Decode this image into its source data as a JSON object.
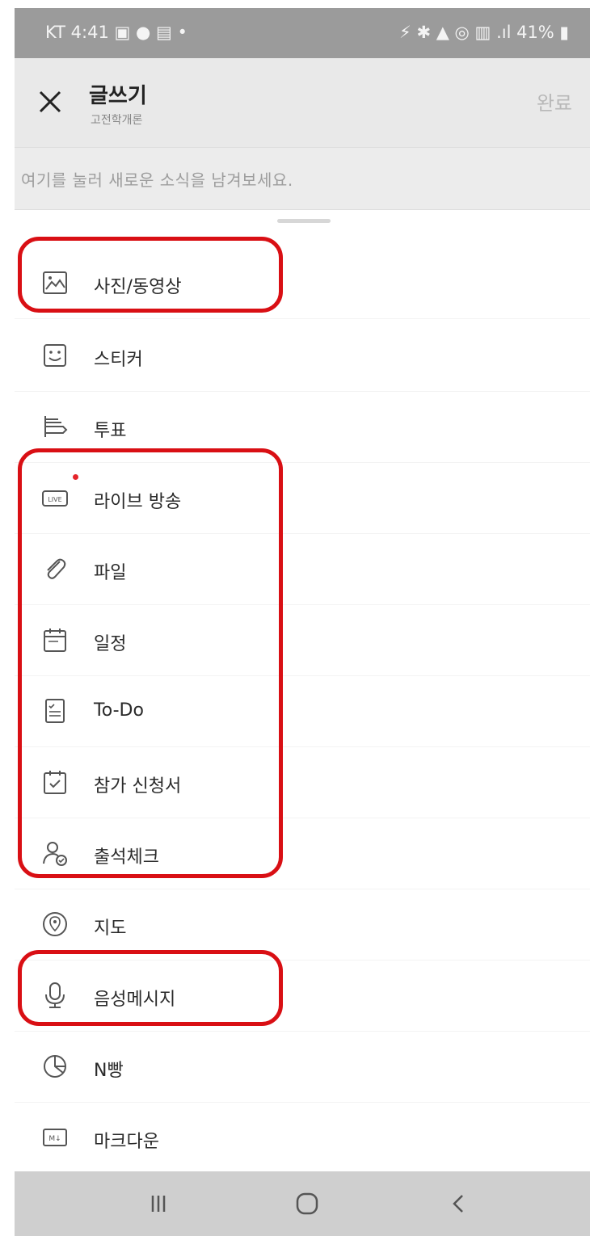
{
  "status_bar": {
    "left_text": "KT 4:41 ▣ ● ▤ •",
    "right_text": "⚡ ✱ ▲ ◎ ▥ .ıl 41% ▮"
  },
  "header": {
    "title": "글쓰기",
    "subtitle": "고전학개론",
    "done_label": "완료"
  },
  "compose": {
    "placeholder": "여기를 눌러 새로운 소식을 남겨보세요."
  },
  "menu": {
    "items": [
      {
        "label": "사진/동영상",
        "icon": "photo-icon"
      },
      {
        "label": "스티커",
        "icon": "sticker-icon"
      },
      {
        "label": "투표",
        "icon": "vote-icon"
      },
      {
        "label": "라이브 방송",
        "icon": "live-icon"
      },
      {
        "label": "파일",
        "icon": "paperclip-icon"
      },
      {
        "label": "일정",
        "icon": "calendar-icon"
      },
      {
        "label": "To-Do",
        "icon": "todo-icon"
      },
      {
        "label": "참가 신청서",
        "icon": "application-form-icon"
      },
      {
        "label": "출석체크",
        "icon": "attendance-icon"
      },
      {
        "label": "지도",
        "icon": "map-pin-icon"
      },
      {
        "label": "음성메시지",
        "icon": "microphone-icon"
      },
      {
        "label": "N빵",
        "icon": "pie-split-icon"
      },
      {
        "label": "마크다운",
        "icon": "markdown-icon"
      }
    ]
  },
  "nav_bar": {
    "buttons": [
      "recent-apps-icon",
      "home-icon",
      "back-icon"
    ]
  },
  "colors": {
    "highlight": "#d90f14",
    "live_dot": "#e5242a",
    "header_bg": "#e9e9e9",
    "status_bg": "#9b9b9b",
    "nav_bg": "#cfcfcf"
  }
}
